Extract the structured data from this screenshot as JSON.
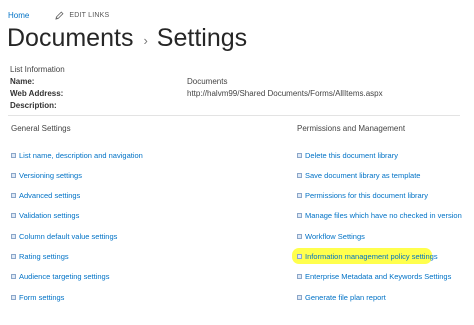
{
  "topnav": {
    "home": "Home",
    "edit_links": "EDIT LINKS"
  },
  "title": {
    "parent": "Documents",
    "separator": "›",
    "current": "Settings"
  },
  "list_information": {
    "heading": "List Information",
    "rows": [
      {
        "label": "Name:",
        "value": "Documents"
      },
      {
        "label": "Web Address:",
        "value": "http://halvm99/Shared Documents/Forms/AllItems.aspx"
      },
      {
        "label": "Description:",
        "value": ""
      }
    ]
  },
  "general_settings": {
    "heading": "General Settings",
    "links": [
      "List name, description and navigation",
      "Versioning settings",
      "Advanced settings",
      "Validation settings",
      "Column default value settings",
      "Rating settings",
      "Audience targeting settings",
      "Form settings"
    ]
  },
  "permissions_management": {
    "heading": "Permissions and Management",
    "links": [
      "Delete this document library",
      "Save document library as template",
      "Permissions for this document library",
      "Manage files which have no checked in version",
      "Workflow Settings",
      "Information management policy settings",
      "Enterprise Metadata and Keywords Settings",
      "Generate file plan report"
    ],
    "highlighted_index": 5
  },
  "colors": {
    "link": "#0072c6",
    "highlight": "#ffff4d"
  }
}
